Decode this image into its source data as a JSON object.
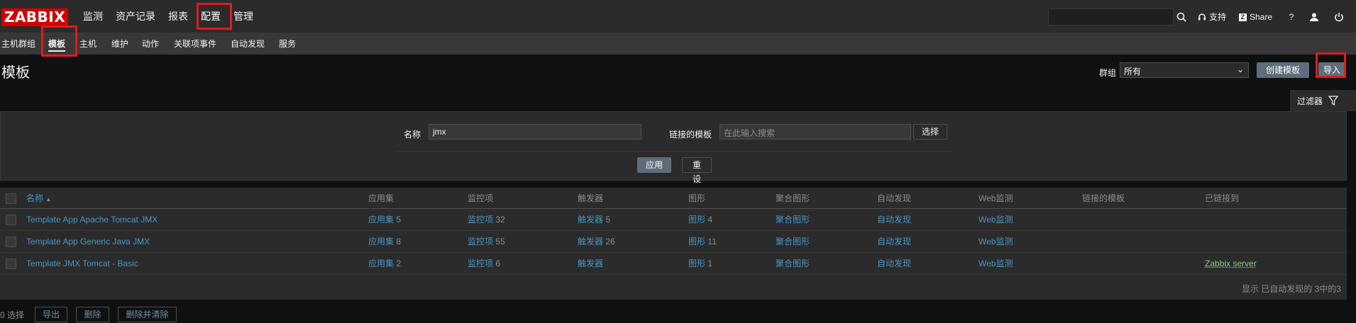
{
  "header": {
    "logo": "ZABBIX",
    "menu": [
      "监测",
      "资产记录",
      "报表",
      "配置",
      "管理"
    ],
    "active_menu_index": 3,
    "search_value": "",
    "support_label": "支持",
    "share_label": "Share",
    "share_logo": "Z",
    "help_label": "?"
  },
  "submenu": {
    "items": [
      "主机群组",
      "模板",
      "主机",
      "维护",
      "动作",
      "关联项事件",
      "自动发现",
      "服务"
    ],
    "active_index": 1
  },
  "page": {
    "title": "模板",
    "group_label": "群组",
    "group_value": "所有",
    "create_button": "创建模板",
    "import_button": "导入"
  },
  "filter": {
    "tab_label": "过滤器",
    "name_label": "名称",
    "name_value": "jmx",
    "linked_label": "链接的模板",
    "linked_placeholder": "在此输入搜索",
    "select_button": "选择",
    "apply_button": "应用",
    "reset_button": "重设"
  },
  "table": {
    "headers": {
      "name": "名称",
      "sort_marker": "▲",
      "applications": "应用集",
      "items": "监控项",
      "triggers": "触发器",
      "graphs": "图形",
      "screens": "聚合图形",
      "discovery": "自动发现",
      "web": "Web监测",
      "linked_templates": "链接的模板",
      "linked_to": "已链接到"
    },
    "rows": [
      {
        "name": "Template App Apache Tomcat JMX",
        "applications": "应用集",
        "applications_count": "5",
        "items": "监控项",
        "items_count": "32",
        "triggers": "触发器",
        "triggers_count": "5",
        "graphs": "图形",
        "graphs_count": "4",
        "screens": "聚合图形",
        "discovery": "自动发现",
        "web": "Web监测",
        "linked_templates": "",
        "linked_to": ""
      },
      {
        "name": "Template App Generic Java JMX",
        "applications": "应用集",
        "applications_count": "8",
        "items": "监控项",
        "items_count": "55",
        "triggers": "触发器",
        "triggers_count": "26",
        "graphs": "图形",
        "graphs_count": "11",
        "screens": "聚合图形",
        "discovery": "自动发现",
        "web": "Web监测",
        "linked_templates": "",
        "linked_to": ""
      },
      {
        "name": "Template JMX Tomcat - Basic",
        "applications": "应用集",
        "applications_count": "2",
        "items": "监控项",
        "items_count": "6",
        "triggers": "触发器",
        "triggers_count": "",
        "graphs": "图形",
        "graphs_count": "1",
        "screens": "聚合图形",
        "discovery": "自动发现",
        "web": "Web监测",
        "linked_templates": "",
        "linked_to": "Zabbix server"
      }
    ],
    "footer": "显示 已自动发现的 3中的3"
  },
  "actions": {
    "selected": "0 选择",
    "export": "导出",
    "delete": "删除",
    "delete_clear": "删除并清除"
  },
  "colors": {
    "background": "#0e1012",
    "panel": "#2b2b2b",
    "link": "#4796c4",
    "logo": "#d40000",
    "highlight_box": "#e01b1b",
    "linked_host": "#86cc89"
  }
}
